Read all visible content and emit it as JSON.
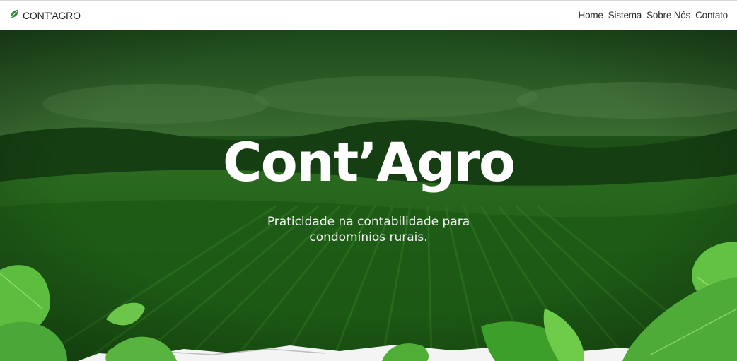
{
  "brand": {
    "name": "CONT'AGRO",
    "icon": "leaf-icon",
    "icon_color": "#2e7d32"
  },
  "nav": {
    "links": [
      {
        "label": "Home"
      },
      {
        "label": "Sistema"
      },
      {
        "label": "Sobre Nós"
      },
      {
        "label": "Contato"
      }
    ]
  },
  "hero": {
    "title": "Cont’Agro",
    "subtitle": "Praticidade na contabilidade para condomínios rurais."
  },
  "colors": {
    "overlay_green": "#1f5a17",
    "leaf_green": "#4caf3a",
    "text_white": "#ffffff"
  }
}
